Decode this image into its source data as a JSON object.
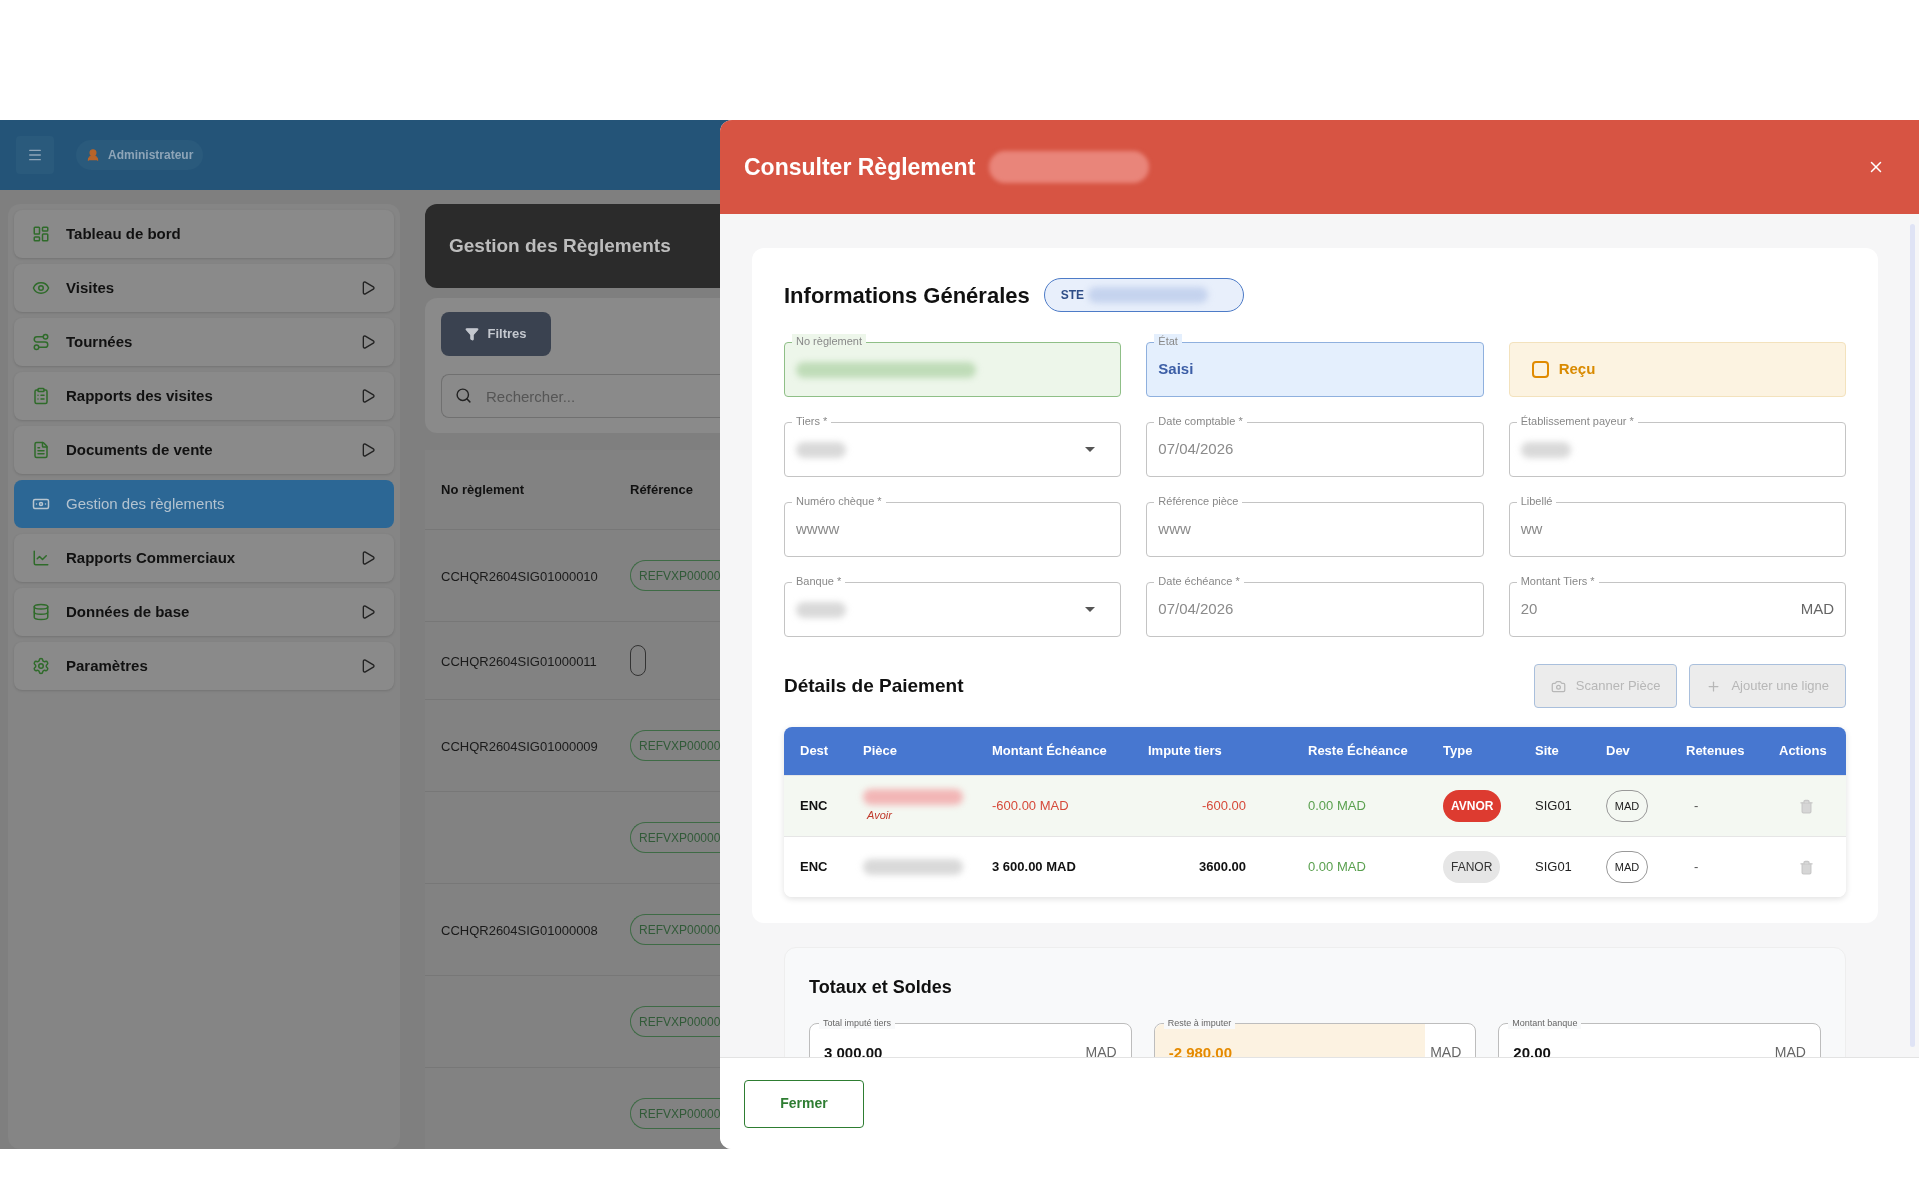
{
  "top_bar": {
    "user": "Administrateur"
  },
  "sidebar": {
    "items": [
      {
        "label": "Tableau de bord",
        "expandable": false,
        "selected": false
      },
      {
        "label": "Visites",
        "expandable": true,
        "selected": false
      },
      {
        "label": "Tournées",
        "expandable": true,
        "selected": false
      },
      {
        "label": "Rapports des visites",
        "expandable": true,
        "selected": false
      },
      {
        "label": "Documents de vente",
        "expandable": true,
        "selected": false
      },
      {
        "label": "Gestion des règlements",
        "expandable": false,
        "selected": true
      },
      {
        "label": "Rapports Commerciaux",
        "expandable": true,
        "selected": false
      },
      {
        "label": "Données de base",
        "expandable": true,
        "selected": false
      },
      {
        "label": "Paramètres",
        "expandable": true,
        "selected": false
      }
    ]
  },
  "list_panel": {
    "title": "Gestion des Règlements",
    "filter_button": "Filtres",
    "search": {
      "placeholder": "Rechercher..."
    },
    "columns": [
      "No règlement",
      "Référence"
    ],
    "rows": [
      {
        "number": "CCHQR2604SIG01000010",
        "reference": "REFVXP00000"
      },
      {
        "number": "CCHQR2604SIG01000011",
        "empty_chip": true
      },
      {
        "number": "CCHQR2604SIG01000009",
        "reference": "REFVXP00000"
      },
      {
        "reference": "REFVXP00000"
      },
      {
        "number": "CCHQR2604SIG01000008",
        "reference": "REFVXP00000"
      },
      {
        "reference": "REFVXP00000"
      },
      {
        "reference": "REFVXP00000"
      }
    ]
  },
  "dialog": {
    "title": "Consulter Règlement",
    "general": {
      "title": "Informations Générales",
      "badge": "STE",
      "fields": [
        {
          "kind": "number",
          "label": "No règlement"
        },
        {
          "kind": "status",
          "label": "État",
          "value": "Saisi"
        },
        {
          "kind": "checkbox",
          "label": "Reçu",
          "checked": false
        },
        {
          "kind": "select",
          "label": "Tiers *"
        },
        {
          "kind": "text",
          "label": "Date comptable *",
          "value": "07/04/2026"
        },
        {
          "kind": "text",
          "label": "Établissement payeur *"
        },
        {
          "kind": "text",
          "label": "Numéro chèque *",
          "value": "wwww"
        },
        {
          "kind": "text",
          "label": "Référence pièce",
          "value": "www"
        },
        {
          "kind": "text",
          "label": "Libellé",
          "value": "ww"
        },
        {
          "kind": "select",
          "label": "Banque *"
        },
        {
          "kind": "text",
          "label": "Date échéance *",
          "value": "07/04/2026"
        },
        {
          "kind": "text",
          "label": "Montant Tiers *",
          "value": "20",
          "suffix": "MAD"
        }
      ]
    },
    "payment": {
      "title": "Détails de Paiement",
      "buttons": [
        {
          "label": "Scanner Pièce",
          "disabled": true
        },
        {
          "label": "Ajouter une ligne",
          "disabled": true
        }
      ],
      "columns": [
        "Dest",
        "Pièce",
        "Montant Échéance",
        "Impute tiers",
        "Reste Échéance",
        "Type",
        "Site",
        "Dev",
        "Retenues",
        "Actions"
      ],
      "rows": [
        {
          "dest": "ENC",
          "piece_note": "Avoir",
          "amount": "-600.00 MAD",
          "imputed": "-600.00",
          "remaining": "0.00 MAD",
          "type": "AVNOR",
          "kind": "credit",
          "site": "SIG01",
          "currency": "MAD",
          "retention": "-",
          "negative": true
        },
        {
          "dest": "ENC",
          "amount": "3 600.00 MAD",
          "imputed": "3600.00",
          "remaining": "0.00 MAD",
          "type": "FANOR",
          "kind": "invoice",
          "site": "SIG01",
          "currency": "MAD",
          "retention": "-",
          "negative": false
        }
      ]
    },
    "totals": {
      "title": "Totaux et Soldes",
      "fields": [
        {
          "label": "Total imputé tiers",
          "value": "3 000.00",
          "suffix": "MAD",
          "highlighted": false
        },
        {
          "label": "Reste à imputer",
          "value": "-2 980.00",
          "suffix": "MAD",
          "highlighted": true
        },
        {
          "label": "Montant banque",
          "value": "20.00",
          "suffix": "MAD",
          "highlighted": false
        }
      ]
    },
    "footer": {
      "close_button": "Fermer"
    }
  }
}
